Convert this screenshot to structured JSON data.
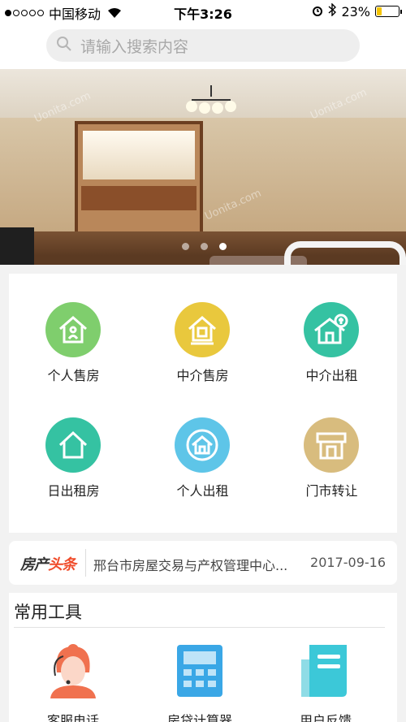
{
  "status_bar": {
    "carrier": "中国移动",
    "time": "下午3:26",
    "battery_percent": "23%",
    "battery_level": 0.23,
    "signal_bars_filled": 1,
    "signal_bars_total": 5
  },
  "search": {
    "placeholder": "请输入搜索内容",
    "icon": "search-icon"
  },
  "banner": {
    "watermark": "Uonita.com",
    "slide_count": 3,
    "active_slide": 3
  },
  "categories": [
    {
      "label": "个人售房",
      "icon": "house-person-icon",
      "color": "#7fce6d"
    },
    {
      "label": "中介售房",
      "icon": "house-agency-icon",
      "color": "#e9c83d"
    },
    {
      "label": "中介出租",
      "icon": "house-money-icon",
      "color": "#35c2a2"
    },
    {
      "label": "日出租房",
      "icon": "house-daily-icon",
      "color": "#35c2a2"
    },
    {
      "label": "个人出租",
      "icon": "house-rent-icon",
      "color": "#5ec5e8"
    },
    {
      "label": "门市转让",
      "icon": "storefront-icon",
      "color": "#d8bc7e"
    }
  ],
  "news": {
    "brand_part1": "房产",
    "brand_part2": "头条",
    "headline": "邢台市房屋交易与产权管理中心...",
    "date": "2017-09-16"
  },
  "tools": {
    "title": "常用工具",
    "items": [
      {
        "label": "客服电话",
        "icon": "customer-service-icon"
      },
      {
        "label": "房贷计算器",
        "icon": "calculator-icon"
      },
      {
        "label": "用户反馈",
        "icon": "feedback-icon"
      }
    ]
  },
  "colors": {
    "accent_orange": "#f0714f",
    "accent_blue": "#3aa7e6",
    "accent_teal": "#3cc8d8",
    "battery_yellow": "#f5c400"
  }
}
